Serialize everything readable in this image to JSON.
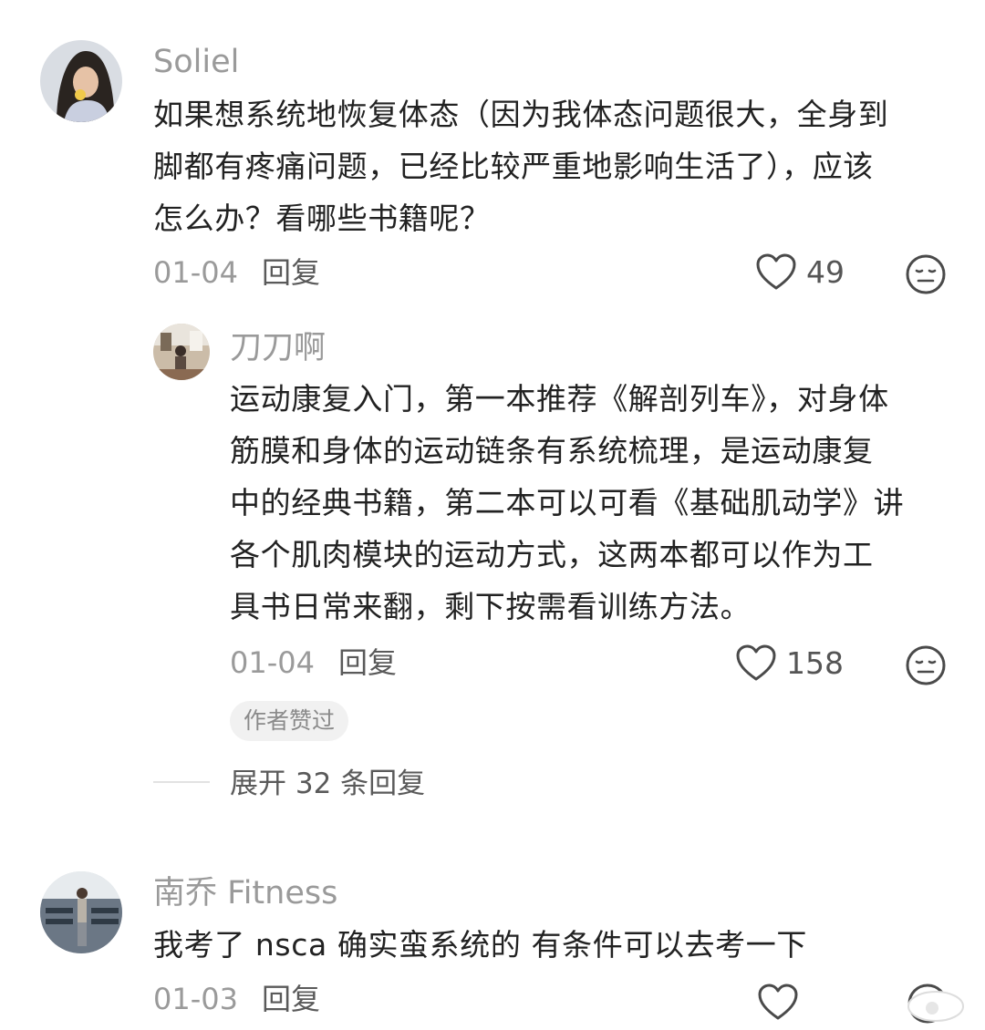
{
  "comments": [
    {
      "username": "Soliel",
      "lines": [
        "如果想系统地恢复体态（因为我体态问题很大，全身到",
        "脚都有疼痛问题，已经比较严重地影响生活了），应该",
        "怎么办？看哪些书籍呢？"
      ],
      "date": "01-04",
      "reply_label": "回复",
      "likes": "49"
    },
    {
      "username": "南乔 Fitness",
      "lines": [
        "我考了 nsca 确实蛮系统的  有条件可以去考一下"
      ],
      "date": "01-03",
      "reply_label": "回复"
    }
  ],
  "reply": {
    "username": "刀刀啊",
    "lines": [
      "运动康复入门，第一本推荐《解剖列车》，对身体",
      "筋膜和身体的运动链条有系统梳理，是运动康复",
      "中的经典书籍，第二本可以可看《基础肌动学》讲",
      "各个肌肉模块的运动方式，这两本都可以作为工",
      "具书日常来翻，剩下按需看训练方法。"
    ],
    "date": "01-04",
    "reply_label": "回复",
    "likes": "158",
    "badge": "作者赞过"
  },
  "expand_replies": "展开 32 条回复",
  "icons": {
    "like": "heart-outline-icon",
    "dislike": "neutral-face-icon"
  },
  "colors": {
    "username": "#9a9a9a",
    "text": "#222222",
    "meta": "#9a9a9a",
    "badge_bg": "#f1f1f1"
  }
}
